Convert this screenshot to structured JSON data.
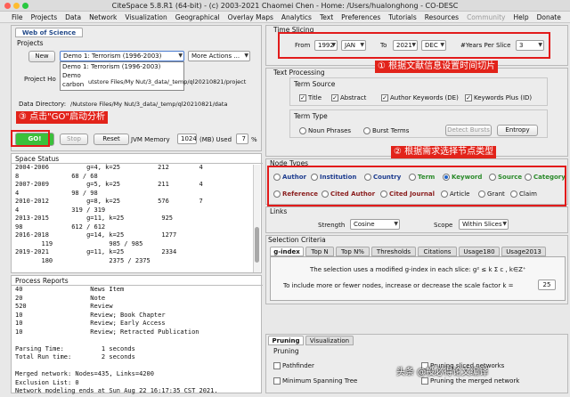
{
  "window": {
    "title": "CiteSpace 5.8.R1 (64-bit) - (c) 2003-2021 Chaomei Chen - Home: /Users/hualonghong - CO-DESC"
  },
  "menu": {
    "items": [
      "File",
      "Projects",
      "Data",
      "Network",
      "Visualization",
      "Geographical",
      "Overlay Maps",
      "Analytics",
      "Text",
      "Preferences",
      "Tutorials",
      "Resources",
      "Community",
      "Help",
      "Donate"
    ]
  },
  "wos_tab": "Web of Science",
  "projects": {
    "title": "Projects",
    "new_label": "New",
    "project_value": "Demo 1: Terrorism (1996-2003)",
    "more_actions": "More Actions ...",
    "dropdown": [
      "Demo 1: Terrorism (1996-2003)",
      "Demo",
      "carbon"
    ],
    "home_label": "Project Ho",
    "home_path": "utstore Files/My Nut/3_data/_temp/ql20210821/project",
    "datadir_label": "Data Directory:",
    "datadir_path": "/Nutstore Files/My Nut/3_data/_temp/ql20210821/data"
  },
  "controls": {
    "go": "GO!",
    "stop": "Stop",
    "reset": "Reset",
    "jvm_label": "JVM Memory",
    "jvm_value": "1024",
    "jvm_unit": "(MB) Used",
    "used_value": "7",
    "used_unit": "%"
  },
  "space_status": {
    "title": "Space Status",
    "lines": [
      "2004-2006          g=4, k=25          212        4",
      "8              68 / 68",
      "2007-2009          g=5, k=25          211        4",
      "4              98 / 98",
      "2010-2012          g=8, k=25          576        7",
      "4              319 / 319",
      "2013-2015          g=11, k=25          925",
      "98             612 / 612",
      "2016-2018          g=14, k=25          1277",
      "       119               985 / 985",
      "2019-2021          g=11, k=25          2334",
      "       180               2375 / 2375"
    ]
  },
  "process": {
    "title": "Process Reports",
    "lines": [
      "40                  News Item",
      "20                  Note",
      "520                 Review",
      "10                  Review; Book Chapter",
      "10                  Review; Early Access",
      "10                  Review; Retracted Publication",
      "",
      "Parsing Time:          1 seconds",
      "Total Run time:        2 seconds",
      "",
      "Merged network: Nodes=435, Links=4200",
      "Exclusion List: 0",
      "Network modeling ends at Sun Aug 22 16:17:35 CST 2021."
    ]
  },
  "time_slicing": {
    "title": "Time Slicing",
    "from_label": "From",
    "from_year": "1992",
    "from_month": "JAN",
    "to_label": "To",
    "to_year": "2021",
    "to_month": "DEC",
    "years_label": "#Years Per Slice",
    "years_value": "3"
  },
  "text_processing": {
    "title": "Text Processing",
    "term_source": "Term Source",
    "sources": [
      {
        "label": "Title",
        "checked": true
      },
      {
        "label": "Abstract",
        "checked": true
      },
      {
        "label": "Author Keywords (DE)",
        "checked": true
      },
      {
        "label": "Keywords Plus (ID)",
        "checked": true
      }
    ],
    "term_type": "Term Type",
    "noun": "Noun Phrases",
    "burst": "Burst Terms",
    "detect": "Detect Bursts",
    "entropy": "Entropy"
  },
  "node_types": {
    "title": "Node Types",
    "row1": [
      {
        "label": "Author",
        "on": false
      },
      {
        "label": "Institution",
        "on": false
      },
      {
        "label": "Country",
        "on": false
      },
      {
        "label": "Term",
        "on": false
      },
      {
        "label": "Keyword",
        "on": true
      },
      {
        "label": "Source",
        "on": false
      },
      {
        "label": "Category",
        "on": false
      }
    ],
    "row2": [
      {
        "label": "Reference",
        "on": false
      },
      {
        "label": "Cited Author",
        "on": false
      },
      {
        "label": "Cited Journal",
        "on": false
      },
      {
        "label": "Article",
        "on": false
      },
      {
        "label": "Grant",
        "on": false
      },
      {
        "label": "Claim",
        "on": false
      }
    ]
  },
  "links": {
    "title": "Links",
    "strength_label": "Strength",
    "strength_value": "Cosine",
    "scope_label": "Scope",
    "scope_value": "Within Slices"
  },
  "criteria": {
    "title": "Selection Criteria",
    "tabs": [
      "g-index",
      "Top N",
      "Top N%",
      "Thresholds",
      "Citations",
      "Usage180",
      "Usage2013"
    ],
    "desc1": "The selection uses a modified g-index in each slice: g² ≤ k Σ c , k∈Z⁺",
    "desc2": "To include more or fewer nodes, increase or decrease the scale factor k =",
    "k_value": "25"
  },
  "pruning": {
    "tabs": [
      "Pruning",
      "Visualization"
    ],
    "title": "Pruning",
    "items": [
      "Pathfinder",
      "Pruning sliced networks",
      "Minimum Spanning Tree",
      "Pruning the merged network"
    ]
  },
  "annotations": {
    "a1": "① 根据文献信息设置时间切片",
    "a2": "② 根据需求选择节点类型",
    "a3": "③ 点击\"GO\"启动分析"
  },
  "watermark": "头条 @投必得论文编译"
}
